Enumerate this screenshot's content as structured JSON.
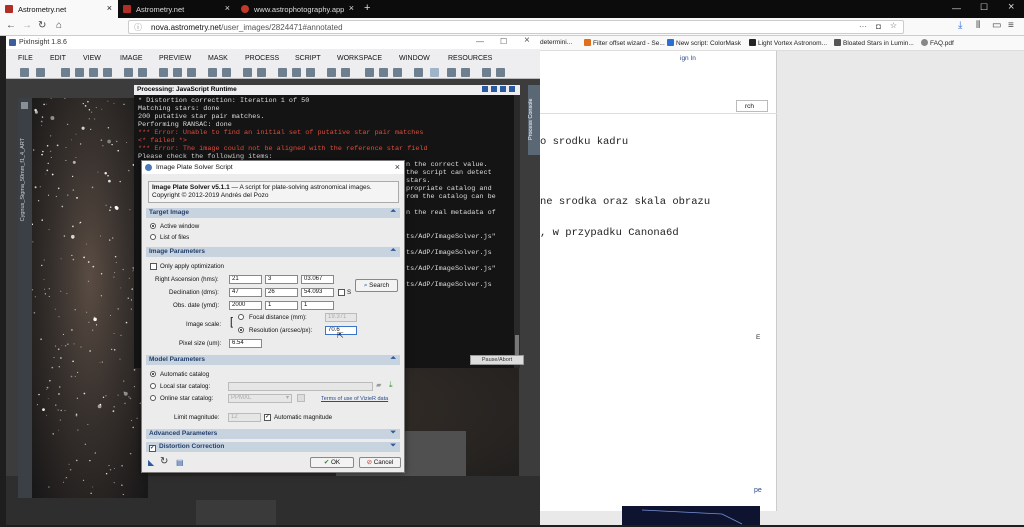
{
  "browser": {
    "tabs": [
      {
        "label": "Astrometry.net",
        "active": true
      },
      {
        "label": "Astrometry.net",
        "active": false
      },
      {
        "label": "www.astrophotography.app",
        "active": false
      }
    ],
    "url_host": "nova.astrometry.net",
    "url_path": "/user_images/2824471#annotated",
    "bookmarks": [
      "determini...",
      "Filter offset wizard - Se...",
      "New script: ColorMask",
      "Light Vortex Astronom...",
      "Bloated Stars in Lumin...",
      "FAQ.pdf"
    ],
    "new_tab_symbol": "+",
    "close_symbol": "×"
  },
  "webpage": {
    "lines": [
      "o srodku kadru",
      "ne srodka oraz skala obrazu",
      ", w przypadku Canona6d"
    ],
    "side_fragments": {
      "search": "rch",
      "sign_in": "ign In",
      "e": "E",
      "pe": "pe"
    }
  },
  "pixinsight": {
    "title": "PixInsight 1.8.6",
    "menu": [
      "FILE",
      "EDIT",
      "VIEW",
      "IMAGE",
      "PREVIEW",
      "MASK",
      "PROCESS",
      "SCRIPT",
      "WORKSPACE",
      "WINDOW",
      "RESOURCES"
    ],
    "image_label": "Cygnus_Sigma_50mm_f1_4_ART",
    "console": {
      "title": "Processing: JavaScript Runtime",
      "vertical_tab": "Process Console",
      "pause_label": "Pause/Abort",
      "lines": [
        {
          "text": "* Distortion correction: Iteration 1 of 50",
          "error": false
        },
        {
          "text": "Matching stars: done",
          "error": false
        },
        {
          "text": "200 putative star pair matches.",
          "error": false
        },
        {
          "text": "Performing RANSAC: done",
          "error": false
        },
        {
          "text": "*** Error: Unable to find an initial set of putative star pair matches",
          "error": true
        },
        {
          "text": "<* failed *>",
          "error": true
        },
        {
          "text": "*** Error: The image could not be aligned with the reference star field",
          "error": true
        },
        {
          "text": "Please check the following items:",
          "error": false
        }
      ],
      "right_lines": [
        "n the correct value.",
        "the script can detect",
        " stars.",
        "propriate catalog and",
        "rom the catalog can be",
        "",
        "n the real metadata of",
        "",
        "",
        "ts/AdP/ImageSolver.js\"",
        "",
        "ts/AdP/ImageSolver.js",
        "",
        "ts/AdP/ImageSolver.js\"",
        "",
        "ts/AdP/ImageSolver.js"
      ]
    },
    "dialog": {
      "title": "Image Plate Solver Script",
      "header_bold": "Image Plate Solver v5.1.1",
      "header_text": " — A script for plate-solving astronomical images.",
      "copyright": "Copyright © 2012-2019 Andrés del Pozo",
      "sections": {
        "target": "Target Image",
        "params": "Image Parameters",
        "model": "Model Parameters",
        "advanced": "Advanced Parameters",
        "distortion": "Distortion Correction"
      },
      "target_options": [
        "Active window",
        "List of files"
      ],
      "only_apply_label": "Only apply optimization",
      "ra_label": "Right Ascension (hms):",
      "ra": [
        "21",
        "3",
        "03.067"
      ],
      "dec_label": "Declination (dms):",
      "dec": [
        "47",
        "26",
        "54.093"
      ],
      "s_label": "S",
      "obs_label": "Obs. date (ymd):",
      "obs": [
        "2000",
        "1",
        "1"
      ],
      "search_label": "Search",
      "scale_label": "Image scale:",
      "focal_label": "Focal distance (mm):",
      "focal_value": "19.371",
      "resolution_label": "Resolution (arcsec/px):",
      "resolution_value": "70.6",
      "pixel_label": "Pixel size (um):",
      "pixel_value": "6.54",
      "catalog_options": [
        "Automatic catalog",
        "Local star catalog:",
        "Online star catalog:"
      ],
      "online_catalog": "PPMXL",
      "terms_link": "Terms of use of VizieR data",
      "limit_label": "Limit magnitude:",
      "limit_value": "12",
      "auto_mag_label": "Automatic magnitude",
      "ok_label": "OK",
      "cancel_label": "Cancel"
    }
  },
  "colors": {
    "accent": "#2c5aa0",
    "error_text": "#e34a3a",
    "console_bg": "#141414",
    "section_bg": "#c8d3e0"
  }
}
